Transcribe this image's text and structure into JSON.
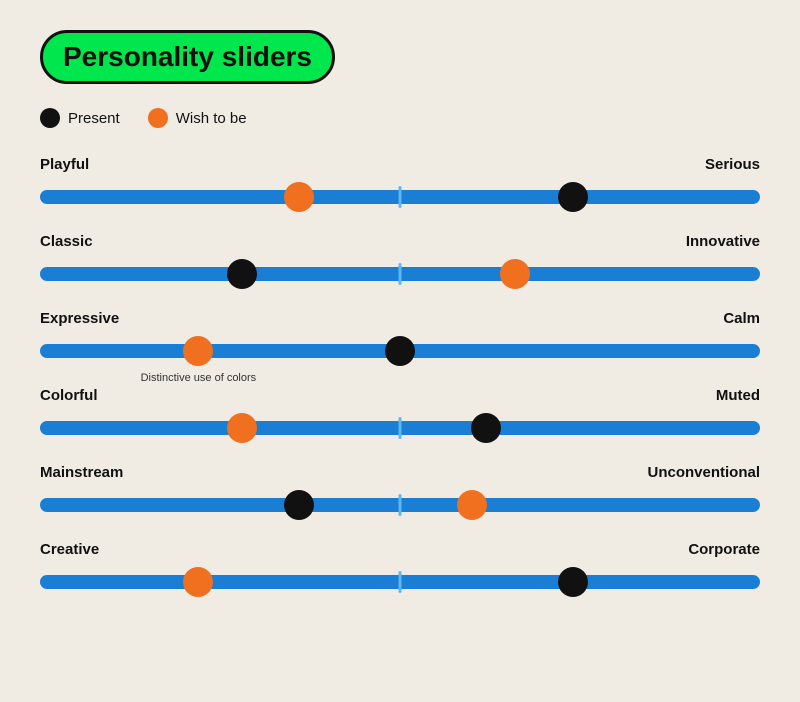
{
  "title": "Personality sliders",
  "legend": {
    "present_label": "Present",
    "wish_label": "Wish to be"
  },
  "sliders": [
    {
      "id": "playful-serious",
      "left_label": "Playful",
      "right_label": "Serious",
      "present_pct": 74,
      "wish_pct": 36,
      "tooltip": null
    },
    {
      "id": "classic-innovative",
      "left_label": "Classic",
      "right_label": "Innovative",
      "present_pct": 28,
      "wish_pct": 66,
      "tooltip": null
    },
    {
      "id": "expressive-calm",
      "left_label": "Expressive",
      "right_label": "Calm",
      "present_pct": 50,
      "wish_pct": 22,
      "tooltip": "Distinctive use of\ncolors"
    },
    {
      "id": "colorful-muted",
      "left_label": "Colorful",
      "right_label": "Muted",
      "present_pct": 62,
      "wish_pct": 28,
      "tooltip": null
    },
    {
      "id": "mainstream-unconventional",
      "left_label": "Mainstream",
      "right_label": "Unconventional",
      "present_pct": 36,
      "wish_pct": 60,
      "tooltip": null
    },
    {
      "id": "creative-corporate",
      "left_label": "Creative",
      "right_label": "Corporate",
      "present_pct": 74,
      "wish_pct": 22,
      "tooltip": null
    }
  ]
}
